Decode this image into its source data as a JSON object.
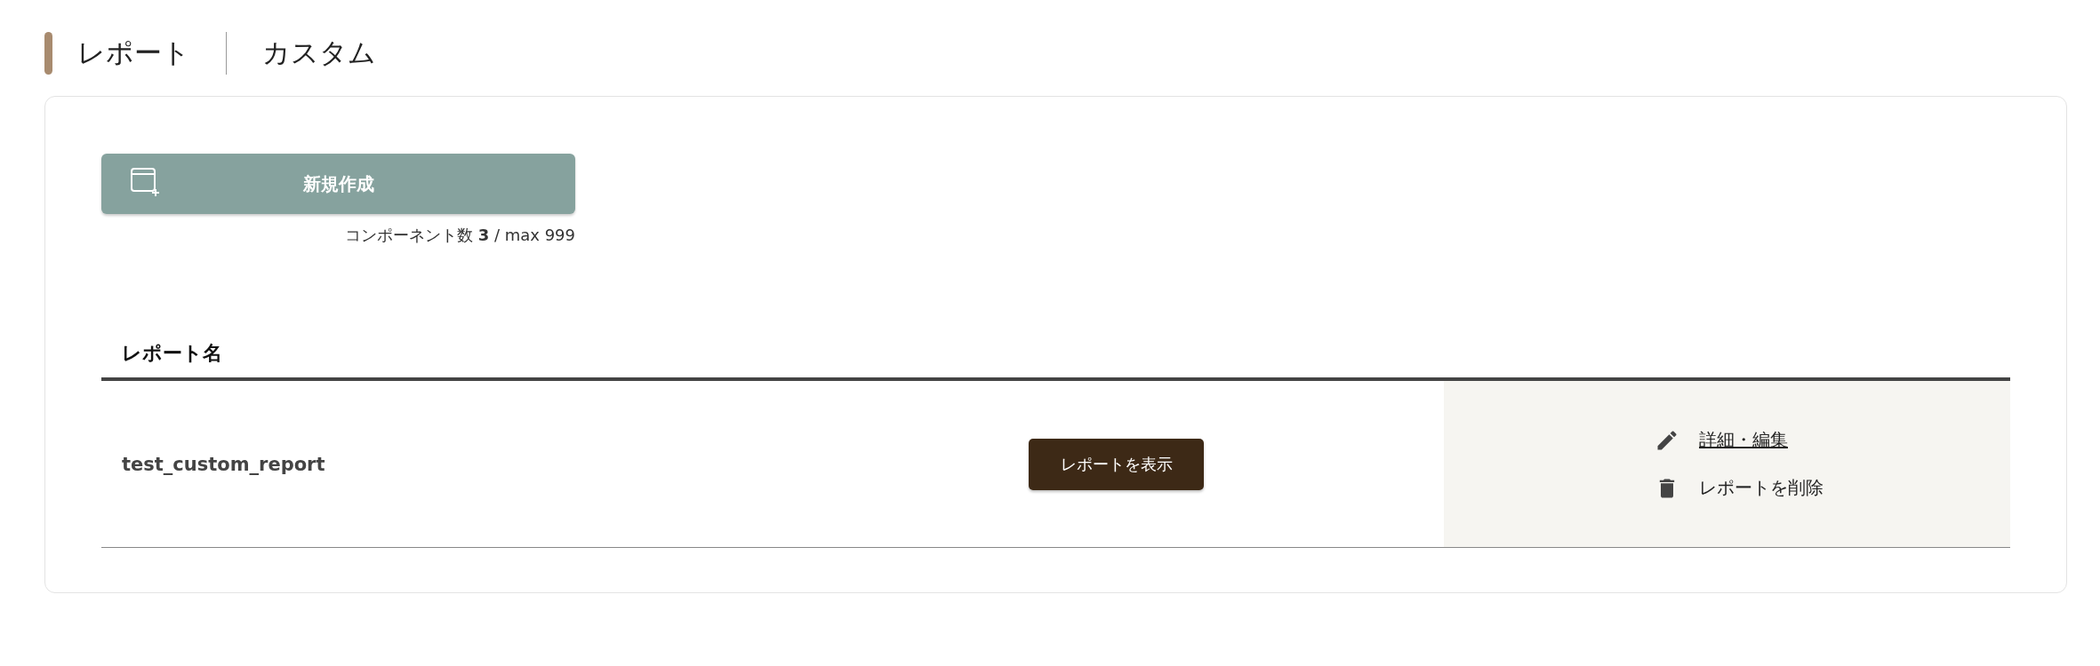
{
  "breadcrumb": [
    "レポート",
    "カスタム"
  ],
  "create_button": {
    "label": "新規作成"
  },
  "counter": {
    "prefix": "コンポーネント数",
    "count": "3",
    "suffix": "/ max 999"
  },
  "table": {
    "columns": [
      "レポート名"
    ],
    "rows": [
      {
        "name": "test_custom_report",
        "view_button": "レポートを表示",
        "actions": [
          {
            "kind": "edit",
            "label": "詳細・編集"
          },
          {
            "kind": "delete",
            "label": "レポートを削除"
          }
        ]
      }
    ]
  }
}
